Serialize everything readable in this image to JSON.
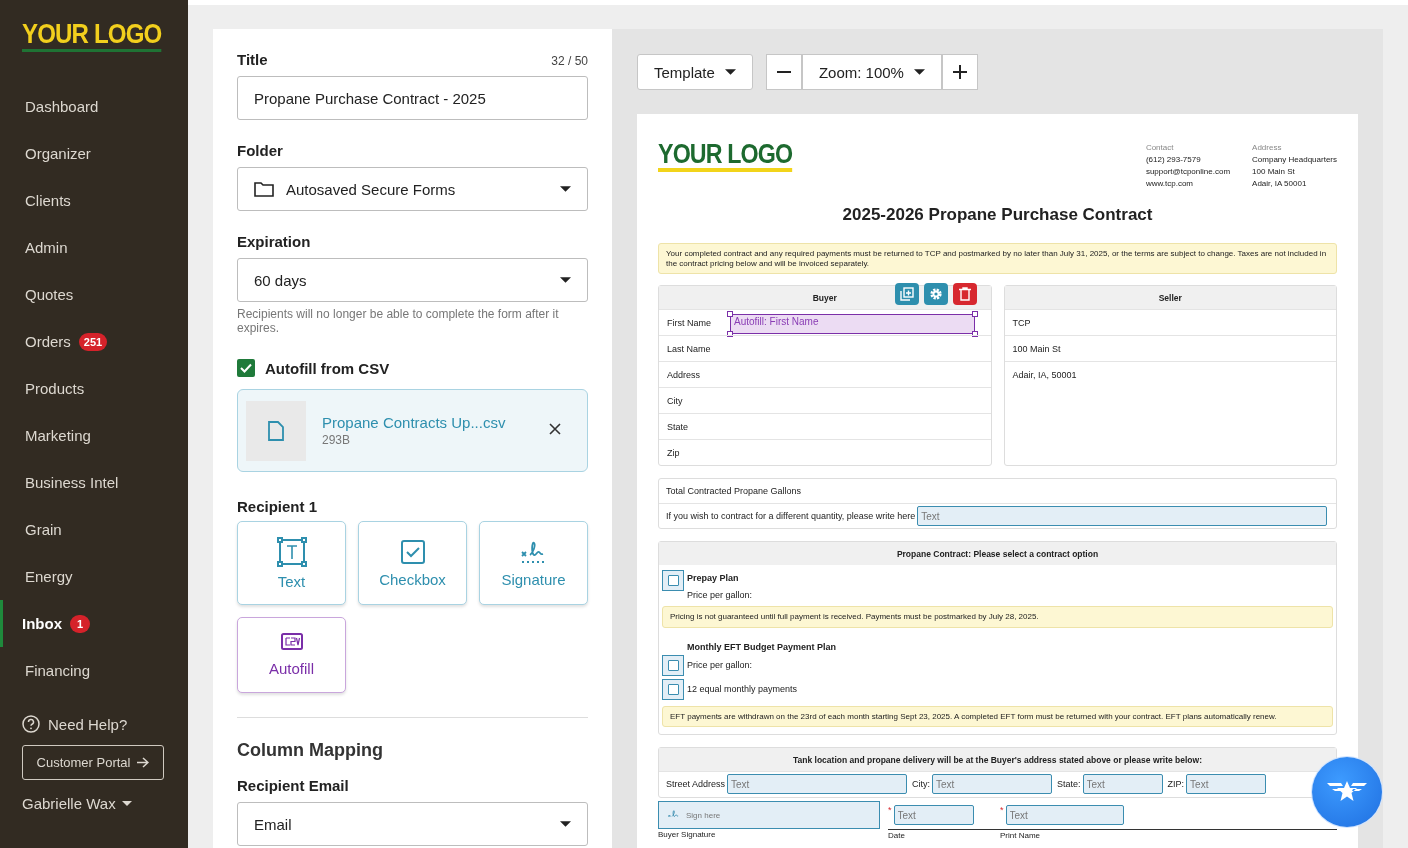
{
  "sidebar": {
    "logo": "YOUR LOGO",
    "items": [
      {
        "label": "Dashboard",
        "selected": false
      },
      {
        "label": "Organizer",
        "selected": false
      },
      {
        "label": "Clients",
        "selected": false
      },
      {
        "label": "Admin",
        "selected": false
      },
      {
        "label": "Quotes",
        "selected": false
      },
      {
        "label": "Orders",
        "selected": false,
        "badge": "251"
      },
      {
        "label": "Products",
        "selected": false
      },
      {
        "label": "Marketing",
        "selected": false
      },
      {
        "label": "Business Intel",
        "selected": false
      },
      {
        "label": "Grain",
        "selected": false
      },
      {
        "label": "Energy",
        "selected": false
      },
      {
        "label": "Inbox",
        "selected": true,
        "badge": "1"
      },
      {
        "label": "Financing",
        "selected": false
      }
    ],
    "help": "Need Help?",
    "portal_button": "Customer Portal",
    "user": "Gabrielle Wax"
  },
  "form": {
    "title": {
      "label": "Title",
      "counter": "32 / 50",
      "value": "Propane Purchase Contract - 2025"
    },
    "folder": {
      "label": "Folder",
      "value": "Autosaved Secure Forms"
    },
    "expiration": {
      "label": "Expiration",
      "value": "60 days",
      "hint": "Recipients will no longer be able to complete the form after it expires."
    },
    "autofill": {
      "label": "Autofill from CSV",
      "checked": true
    },
    "file": {
      "name": "Propane Contracts Up...csv",
      "size": "293B"
    },
    "recipient": {
      "label": "Recipient 1",
      "tools": [
        {
          "kind": "text",
          "label": "Text"
        },
        {
          "kind": "checkbox",
          "label": "Checkbox"
        },
        {
          "kind": "signature",
          "label": "Signature"
        },
        {
          "kind": "autofill",
          "label": "Autofill"
        }
      ]
    },
    "column_mapping": {
      "heading": "Column Mapping",
      "field_label": "Recipient Email",
      "value": "Email"
    }
  },
  "toolbar": {
    "template": "Template",
    "zoom": "Zoom: 100%"
  },
  "document": {
    "logo": "YOUR LOGO",
    "contact": {
      "heading": "Contact",
      "lines": [
        "(612) 293-7579",
        "support@tcponline.com",
        "www.tcp.com"
      ]
    },
    "address": {
      "heading": "Address",
      "lines": [
        "Company Headquarters",
        "100 Main St",
        "Adair, IA 50001"
      ]
    },
    "title": "2025-2026 Propane Purchase Contract",
    "notice": "Your completed contract and any required payments must be returned to TCP and postmarked by no later than July 31, 2025, or the terms are subject to change. Taxes are not included in the contract pricing below and will be invoiced separately.",
    "buyer": {
      "heading": "Buyer",
      "rows": [
        "First Name",
        "Last Name",
        "Address",
        "City",
        "State",
        "Zip"
      ],
      "selected_field": "Autofill: First Name"
    },
    "seller": {
      "heading": "Seller",
      "rows": [
        "TCP",
        "100 Main St",
        "Adair, IA, 50001"
      ]
    },
    "gallons": {
      "label": "Total Contracted Propane Gallons",
      "prompt": "If you wish to contract for a different quantity, please write here",
      "placeholder": "Text"
    },
    "contract": {
      "heading": "Propane Contract: Please select a contract option",
      "items": [
        {
          "kind": "plan",
          "title": "Prepay Plan",
          "text": "Price per gallon:",
          "checked": false
        },
        {
          "kind": "note",
          "text": "Pricing is not guaranteed until full payment is received. Payments must be postmarked by July 28, 2025."
        },
        {
          "kind": "heading",
          "text": "Monthly EFT Budget Payment Plan"
        },
        {
          "kind": "check",
          "text": "Price per gallon:",
          "checked": false
        },
        {
          "kind": "check",
          "text": "12 equal monthly payments",
          "checked": false
        },
        {
          "kind": "note",
          "text": "EFT payments are withdrawn on the 23rd of each month starting Sept 23, 2025. A completed EFT form must be returned with your contract. EFT plans automatically renew."
        }
      ]
    },
    "delivery": {
      "heading": "Tank location and propane delivery will be at the Buyer's address stated above or please write below:",
      "fields": [
        {
          "label": "Street Address",
          "placeholder": "Text"
        },
        {
          "label": "City:",
          "placeholder": "Text"
        },
        {
          "label": "State:",
          "placeholder": "Text"
        },
        {
          "label": "ZIP:",
          "placeholder": "Text"
        }
      ]
    },
    "signatures": {
      "required_mark": "*",
      "sign_placeholder": "Sign here",
      "date_placeholder": "Text",
      "name_placeholder": "Text",
      "labels": [
        "Buyer Signature",
        "Date",
        "Print Name"
      ]
    }
  }
}
